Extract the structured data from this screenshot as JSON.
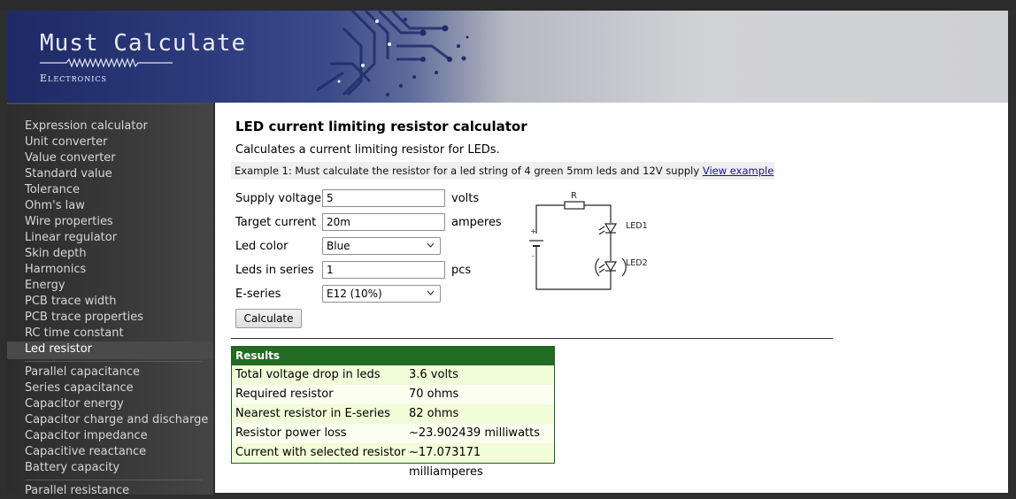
{
  "site": {
    "logo_title": "Must Calculate",
    "logo_subtitle": "Electronics"
  },
  "sidebar": {
    "items": [
      {
        "label": "Expression calculator"
      },
      {
        "label": "Unit converter"
      },
      {
        "label": "Value converter"
      },
      {
        "label": "Standard value"
      },
      {
        "label": "Tolerance"
      },
      {
        "label": "Ohm's law"
      },
      {
        "label": "Wire properties"
      },
      {
        "label": "Linear regulator"
      },
      {
        "label": "Skin depth"
      },
      {
        "label": "Harmonics"
      },
      {
        "label": "Energy"
      },
      {
        "label": "PCB trace width"
      },
      {
        "label": "PCB trace properties"
      },
      {
        "label": "RC time constant"
      },
      {
        "label": "Led resistor",
        "active": true
      },
      {
        "label": "Parallel capacitance"
      },
      {
        "label": "Series capacitance"
      },
      {
        "label": "Capacitor energy"
      },
      {
        "label": "Capacitor charge and discharge"
      },
      {
        "label": "Capacitor impedance"
      },
      {
        "label": "Capacitive reactance"
      },
      {
        "label": "Battery capacity"
      },
      {
        "label": "Parallel resistance"
      }
    ]
  },
  "main": {
    "title": "LED current limiting resistor calculator",
    "description": "Calculates a current limiting resistor for LEDs.",
    "example_text": "Example 1: Must calculate the resistor for a led string of 4 green 5mm leds and 12V supply",
    "example_link": "View example",
    "form": {
      "supply_voltage": {
        "label": "Supply voltage",
        "value": "5",
        "unit": "volts"
      },
      "target_current": {
        "label": "Target current",
        "value": "20m",
        "unit": "amperes"
      },
      "led_color": {
        "label": "Led color",
        "value": "Blue"
      },
      "leds_in_series": {
        "label": "Leds in series",
        "value": "1",
        "unit": "pcs"
      },
      "e_series": {
        "label": "E-series",
        "value": "E12 (10%)"
      },
      "calculate_label": "Calculate"
    },
    "schematic": {
      "resistor_label": "R",
      "led1_label": "LED1",
      "led2_label": "LED2",
      "plus_label": "+",
      "minus_label": "-"
    },
    "results": {
      "header": "Results",
      "rows": [
        {
          "label": "Total voltage drop in leds",
          "value": "3.6 volts"
        },
        {
          "label": "Required resistor",
          "value": "70 ohms"
        },
        {
          "label": "Nearest resistor in E-series",
          "value": "82 ohms"
        },
        {
          "label": "Resistor power loss",
          "value": "~23.902439 milliwatts"
        },
        {
          "label": "Current with selected resistor",
          "value": "~17.073171 milliamperes"
        }
      ]
    }
  },
  "colors": {
    "results_header": "#226b22",
    "link": "#1a0dab",
    "sidebar_bg": "#3a3a3a"
  }
}
